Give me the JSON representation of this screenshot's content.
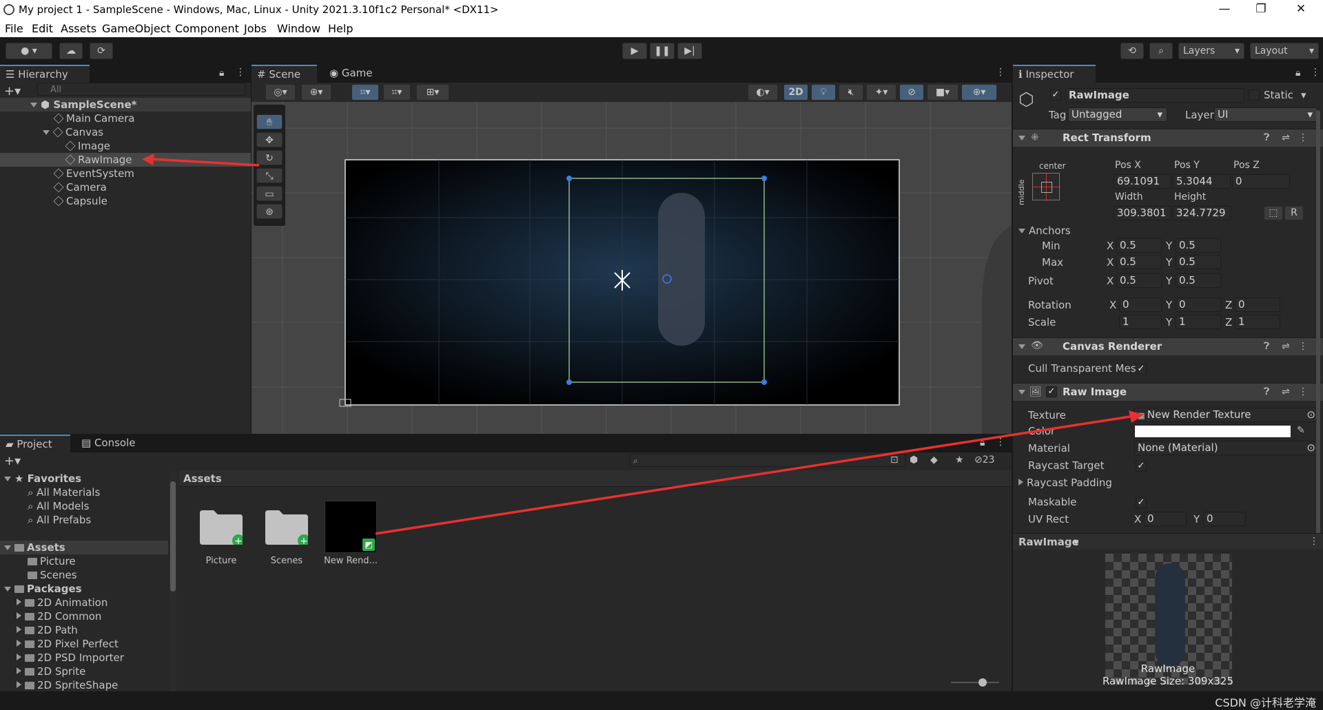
{
  "window": {
    "title": "My project  1 - SampleScene - Windows, Mac, Linux - Unity 2021.3.10f1c2 Personal* <DX11>"
  },
  "menu": [
    "File",
    "Edit",
    "Assets",
    "GameObject",
    "Component",
    "Jobs",
    "Window",
    "Help"
  ],
  "toolbar": {
    "account_icon": "account-icon",
    "layers": "Layers",
    "layout": "Layout"
  },
  "hierarchy": {
    "title": "Hierarchy",
    "search_placeholder": "All",
    "scene": "SampleScene*",
    "items": [
      "Main Camera",
      "Canvas",
      "Image",
      "RawImage",
      "EventSystem",
      "Camera",
      "Capsule"
    ]
  },
  "scene_view": {
    "tabs": [
      "Scene",
      "Game"
    ],
    "btn_2d": "2D"
  },
  "project": {
    "tabs": [
      "Project",
      "Console"
    ],
    "favorites": "Favorites",
    "fav_items": [
      "All Materials",
      "All Models",
      "All Prefabs"
    ],
    "assets": "Assets",
    "asset_items": [
      "Picture",
      "Scenes"
    ],
    "packages": "Packages",
    "package_items": [
      "2D Animation",
      "2D Common",
      "2D Path",
      "2D Pixel Perfect",
      "2D PSD Importer",
      "2D Sprite",
      "2D SpriteShape"
    ],
    "breadcrumb": "Assets",
    "hidden_count": "23",
    "grid": [
      "Picture",
      "Scenes",
      "New Rend..."
    ]
  },
  "inspector": {
    "title": "Inspector",
    "object_name": "RawImage",
    "static": "Static",
    "tag_label": "Tag",
    "tag": "Untagged",
    "layer_label": "Layer",
    "layer": "UI",
    "rect": {
      "title": "Rect Transform",
      "anchor_h": "center",
      "anchor_v": "middle",
      "posx_l": "Pos X",
      "posy_l": "Pos Y",
      "posz_l": "Pos Z",
      "posx": "69.1091",
      "posy": "5.3044",
      "posz": "0",
      "width_l": "Width",
      "height_l": "Height",
      "width": "309.3801",
      "height": "324.7729",
      "r": "R",
      "anchors": "Anchors",
      "min": "Min",
      "max": "Max",
      "pivot": "Pivot",
      "x": "X",
      "y": "Y",
      "z": "Z",
      "min_x": "0.5",
      "min_y": "0.5",
      "max_x": "0.5",
      "max_y": "0.5",
      "pivot_x": "0.5",
      "pivot_y": "0.5",
      "rotation": "Rotation",
      "rot_x": "0",
      "rot_y": "0",
      "rot_z": "0",
      "scale": "Scale",
      "sc_x": "1",
      "sc_y": "1",
      "sc_z": "1"
    },
    "canvas_renderer": {
      "title": "Canvas Renderer",
      "cull": "Cull Transparent Mes"
    },
    "raw_image": {
      "title": "Raw Image",
      "texture_l": "Texture",
      "texture": "New Render Texture",
      "color_l": "Color",
      "material_l": "Material",
      "material": "None (Material)",
      "raycast_target": "Raycast Target",
      "raycast_padding": "Raycast Padding",
      "maskable": "Maskable",
      "uv_rect": "UV Rect",
      "uv_x": "0",
      "uv_y": "0"
    },
    "preview": {
      "title": "RawImage",
      "name": "RawImage",
      "size": "RawImage Size: 309x325"
    }
  },
  "watermark": "CSDN @计科老学淹",
  "colors": {
    "accent": "#4a8ac9",
    "arrow": "#e8312f",
    "panel": "#282828"
  }
}
